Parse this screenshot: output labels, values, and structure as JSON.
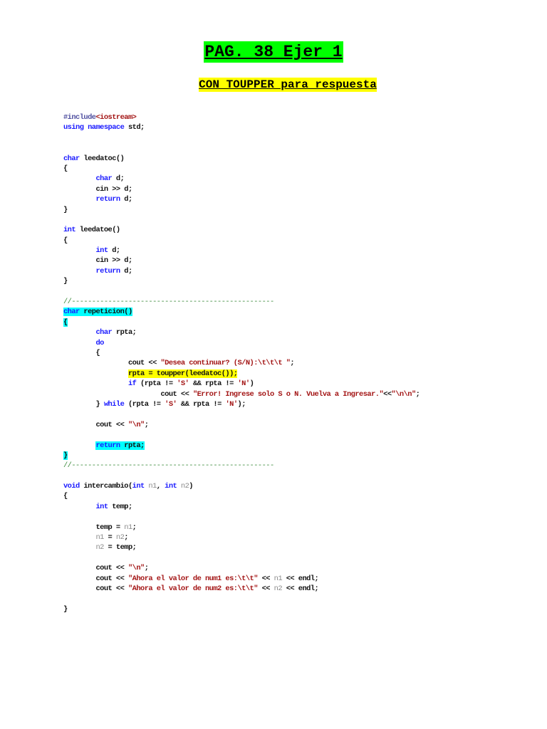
{
  "title": "PAG. 38 Ejer 1",
  "subtitle": "CON TOUPPER para respuesta",
  "colors": {
    "title_bg": "#00ff00",
    "subtitle_bg": "#ffff00",
    "keyword": "#1a1aff",
    "string": "#a31515",
    "param": "#8a8a8a",
    "comment": "#3a8a3a",
    "highlight_cyan": "#00ffff",
    "highlight_yellow": "#ffff00"
  },
  "code_lines": [
    [
      [
        "#include",
        "pp"
      ],
      [
        "<iostream>",
        "s"
      ]
    ],
    [
      [
        "using",
        "k"
      ],
      [
        " ",
        "n"
      ],
      [
        "namespace",
        "k"
      ],
      [
        " std;",
        "n"
      ]
    ],
    [],
    [],
    [
      [
        "char",
        "k"
      ],
      [
        " leedatoc()",
        "n"
      ]
    ],
    [
      [
        "{",
        "n"
      ]
    ],
    [
      [
        "\t",
        "n"
      ],
      [
        "char",
        "k"
      ],
      [
        " d;",
        "n"
      ]
    ],
    [
      [
        "\tcin >> d;",
        "n"
      ]
    ],
    [
      [
        "\t",
        "n"
      ],
      [
        "return",
        "k"
      ],
      [
        " d;",
        "n"
      ]
    ],
    [
      [
        "}",
        "n"
      ]
    ],
    [],
    [
      [
        "int",
        "k"
      ],
      [
        " leedatoe()",
        "n"
      ]
    ],
    [
      [
        "{",
        "n"
      ]
    ],
    [
      [
        "\t",
        "n"
      ],
      [
        "int",
        "k"
      ],
      [
        " d;",
        "n"
      ]
    ],
    [
      [
        "\tcin >> d;",
        "n"
      ]
    ],
    [
      [
        "\t",
        "n"
      ],
      [
        "return",
        "k"
      ],
      [
        " d;",
        "n"
      ]
    ],
    [
      [
        "}",
        "n"
      ]
    ],
    [],
    [
      [
        "//--------------------------------------------------",
        "c"
      ]
    ],
    [
      [
        "char",
        "k hc"
      ],
      [
        " repeticion()",
        "n hc"
      ]
    ],
    [
      [
        "{",
        "n hc"
      ]
    ],
    [
      [
        "\t",
        "n"
      ],
      [
        "char",
        "k"
      ],
      [
        " rpta;",
        "n"
      ]
    ],
    [
      [
        "\t",
        "n"
      ],
      [
        "do",
        "k"
      ]
    ],
    [
      [
        "\t{",
        "n"
      ]
    ],
    [
      [
        "\t\tcout << ",
        "n"
      ],
      [
        "\"Desea continuar? (S/N):\\t\\t\\t \"",
        "s"
      ],
      [
        ";",
        "n"
      ]
    ],
    [
      [
        "\t\t",
        "n"
      ],
      [
        "rpta = toupper(leedatoc());",
        "n hy"
      ]
    ],
    [
      [
        "\t\t",
        "n"
      ],
      [
        "if",
        "k"
      ],
      [
        " (rpta != ",
        "n"
      ],
      [
        "'S'",
        "s"
      ],
      [
        " && rpta != ",
        "n"
      ],
      [
        "'N'",
        "s"
      ],
      [
        ")",
        "n"
      ]
    ],
    [
      [
        "\t\t\tcout << ",
        "n"
      ],
      [
        "\"Error! Ingrese solo S o N. Vuelva a Ingresar.\"",
        "s"
      ],
      [
        "<<",
        "n"
      ],
      [
        "\"\\n\\n\"",
        "s"
      ],
      [
        ";",
        "n"
      ]
    ],
    [
      [
        "\t} ",
        "n"
      ],
      [
        "while",
        "k"
      ],
      [
        " (rpta != ",
        "n"
      ],
      [
        "'S'",
        "s"
      ],
      [
        " && rpta != ",
        "n"
      ],
      [
        "'N'",
        "s"
      ],
      [
        ");",
        "n"
      ]
    ],
    [],
    [
      [
        "\tcout << ",
        "n"
      ],
      [
        "\"\\n\"",
        "s"
      ],
      [
        ";",
        "n"
      ]
    ],
    [],
    [
      [
        "\t",
        "n"
      ],
      [
        "return",
        "k hc"
      ],
      [
        " rpta;",
        "n hc"
      ]
    ],
    [
      [
        "}",
        "n hc"
      ]
    ],
    [
      [
        "//--------------------------------------------------",
        "c"
      ]
    ],
    [],
    [
      [
        "void",
        "k"
      ],
      [
        " intercambio(",
        "n"
      ],
      [
        "int",
        "k"
      ],
      [
        " ",
        "n"
      ],
      [
        "n1",
        "p"
      ],
      [
        ", ",
        "n"
      ],
      [
        "int",
        "k"
      ],
      [
        " ",
        "n"
      ],
      [
        "n2",
        "p"
      ],
      [
        ")",
        "n"
      ]
    ],
    [
      [
        "{",
        "n"
      ]
    ],
    [
      [
        "\t",
        "n"
      ],
      [
        "int",
        "k"
      ],
      [
        " temp;",
        "n"
      ]
    ],
    [],
    [
      [
        "\ttemp = ",
        "n"
      ],
      [
        "n1",
        "p"
      ],
      [
        ";",
        "n"
      ]
    ],
    [
      [
        "\t",
        "n"
      ],
      [
        "n1",
        "p"
      ],
      [
        " = ",
        "n"
      ],
      [
        "n2",
        "p"
      ],
      [
        ";",
        "n"
      ]
    ],
    [
      [
        "\t",
        "n"
      ],
      [
        "n2",
        "p"
      ],
      [
        " = temp;",
        "n"
      ]
    ],
    [],
    [
      [
        "\tcout << ",
        "n"
      ],
      [
        "\"\\n\"",
        "s"
      ],
      [
        ";",
        "n"
      ]
    ],
    [
      [
        "\tcout << ",
        "n"
      ],
      [
        "\"Ahora el valor de num1 es:\\t\\t\"",
        "s"
      ],
      [
        " << ",
        "n"
      ],
      [
        "n1",
        "p"
      ],
      [
        " << endl;",
        "n"
      ]
    ],
    [
      [
        "\tcout << ",
        "n"
      ],
      [
        "\"Ahora el valor de num2 es:\\t\\t\"",
        "s"
      ],
      [
        " << ",
        "n"
      ],
      [
        "n2",
        "p"
      ],
      [
        " << endl;",
        "n"
      ]
    ],
    [],
    [
      [
        "}",
        "n"
      ]
    ]
  ]
}
